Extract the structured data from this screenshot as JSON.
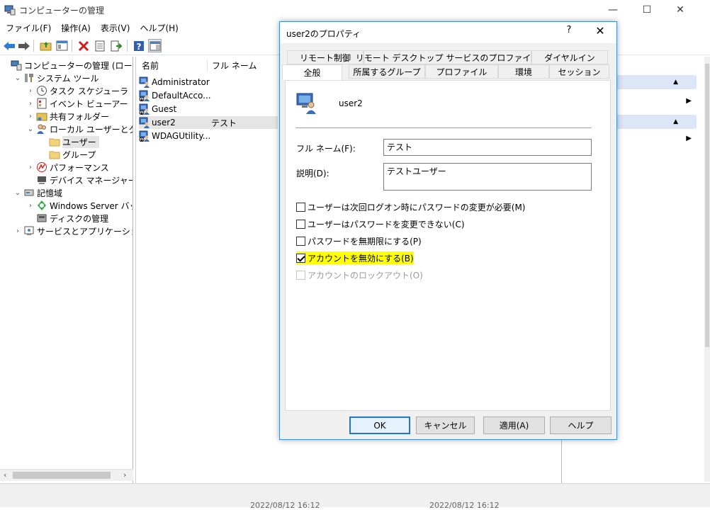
{
  "window": {
    "title": "コンピューターの管理",
    "controls": [
      "—",
      "☐",
      "✕"
    ]
  },
  "menu": [
    "ファイル(F)",
    "操作(A)",
    "表示(V)",
    "ヘルプ(H)"
  ],
  "tree": [
    {
      "label": "コンピューターの管理 (ローカル)",
      "level": 0,
      "chev": "",
      "name": "tree-item-computer-management",
      "icon": "computer-management-icon"
    },
    {
      "label": "システム ツール",
      "level": 1,
      "chev": "⌄",
      "name": "tree-item-system-tools",
      "icon": "tools-icon"
    },
    {
      "label": "タスク スケジューラ",
      "level": 2,
      "chev": "›",
      "name": "tree-item-task-scheduler",
      "icon": "clock-icon"
    },
    {
      "label": "イベント ビューアー",
      "level": 2,
      "chev": "›",
      "name": "tree-item-event-viewer",
      "icon": "event-viewer-icon"
    },
    {
      "label": "共有フォルダー",
      "level": 2,
      "chev": "›",
      "name": "tree-item-shared-folders",
      "icon": "shared-folder-icon"
    },
    {
      "label": "ローカル ユーザーとグループ",
      "level": 2,
      "chev": "⌄",
      "name": "tree-item-local-users-groups",
      "icon": "users-group-icon"
    },
    {
      "label": "ユーザー",
      "level": 3,
      "chev": "",
      "name": "tree-item-users",
      "icon": "folder-icon",
      "selected": true
    },
    {
      "label": "グループ",
      "level": 3,
      "chev": "",
      "name": "tree-item-groups",
      "icon": "folder-icon"
    },
    {
      "label": "パフォーマンス",
      "level": 2,
      "chev": "›",
      "name": "tree-item-performance",
      "icon": "performance-icon"
    },
    {
      "label": "デバイス マネージャー",
      "level": 2,
      "chev": "",
      "name": "tree-item-device-manager",
      "icon": "device-manager-icon"
    },
    {
      "label": "記憶域",
      "level": 1,
      "chev": "⌄",
      "name": "tree-item-storage",
      "icon": "storage-icon"
    },
    {
      "label": "Windows Server バックアップ",
      "level": 2,
      "chev": "›",
      "name": "tree-item-windows-server-backup",
      "icon": "backup-icon"
    },
    {
      "label": "ディスクの管理",
      "level": 2,
      "chev": "",
      "name": "tree-item-disk-management",
      "icon": "disk-icon"
    },
    {
      "label": "サービスとアプリケーション",
      "level": 1,
      "chev": "›",
      "name": "tree-item-services-apps",
      "icon": "services-icon"
    }
  ],
  "list": {
    "columns": [
      "名前",
      "フル ネーム"
    ],
    "rows": [
      {
        "name": "Administrator",
        "fullname": ""
      },
      {
        "name": "DefaultAcco...",
        "fullname": ""
      },
      {
        "name": "Guest",
        "fullname": ""
      },
      {
        "name": "user2",
        "fullname": "テスト",
        "selected": true
      },
      {
        "name": "WDAGUtility...",
        "fullname": ""
      }
    ]
  },
  "status": {
    "date1": "2022/08/12 16:12",
    "date2": "2022/08/12 16:12"
  },
  "dialog": {
    "title": "user2のプロパティ",
    "help": "?",
    "close": "✕",
    "tabs_row1": [
      "リモート制御",
      "リモート デスクトップ サービスのプロファイル",
      "ダイヤルイン"
    ],
    "tabs_row2": [
      "全般",
      "所属するグループ",
      "プロファイル",
      "環境",
      "セッション"
    ],
    "username": "user2",
    "fullname_label": "フル ネーム(F):",
    "fullname_value": "テスト",
    "desc_label": "説明(D):",
    "desc_value": "テストユーザー",
    "checkboxes": [
      {
        "label": "ユーザーは次回ログオン時にパスワードの変更が必要(M)",
        "checked": false,
        "disabled": false
      },
      {
        "label": "ユーザーはパスワードを変更できない(C)",
        "checked": false,
        "disabled": false
      },
      {
        "label": "パスワードを無期限にする(P)",
        "checked": false,
        "disabled": false
      },
      {
        "label": "アカウントを無効にする(B)",
        "checked": true,
        "disabled": false,
        "highlight": true
      },
      {
        "label": "アカウントのロックアウト(O)",
        "checked": false,
        "disabled": true
      }
    ],
    "buttons": {
      "ok": "OK",
      "cancel": "キャンセル",
      "apply": "適用(A)",
      "help": "ヘルプ"
    }
  },
  "colors": {
    "accent": "#2276d1",
    "highlight": "#ffff00",
    "action_header": "#dbe7f6"
  }
}
